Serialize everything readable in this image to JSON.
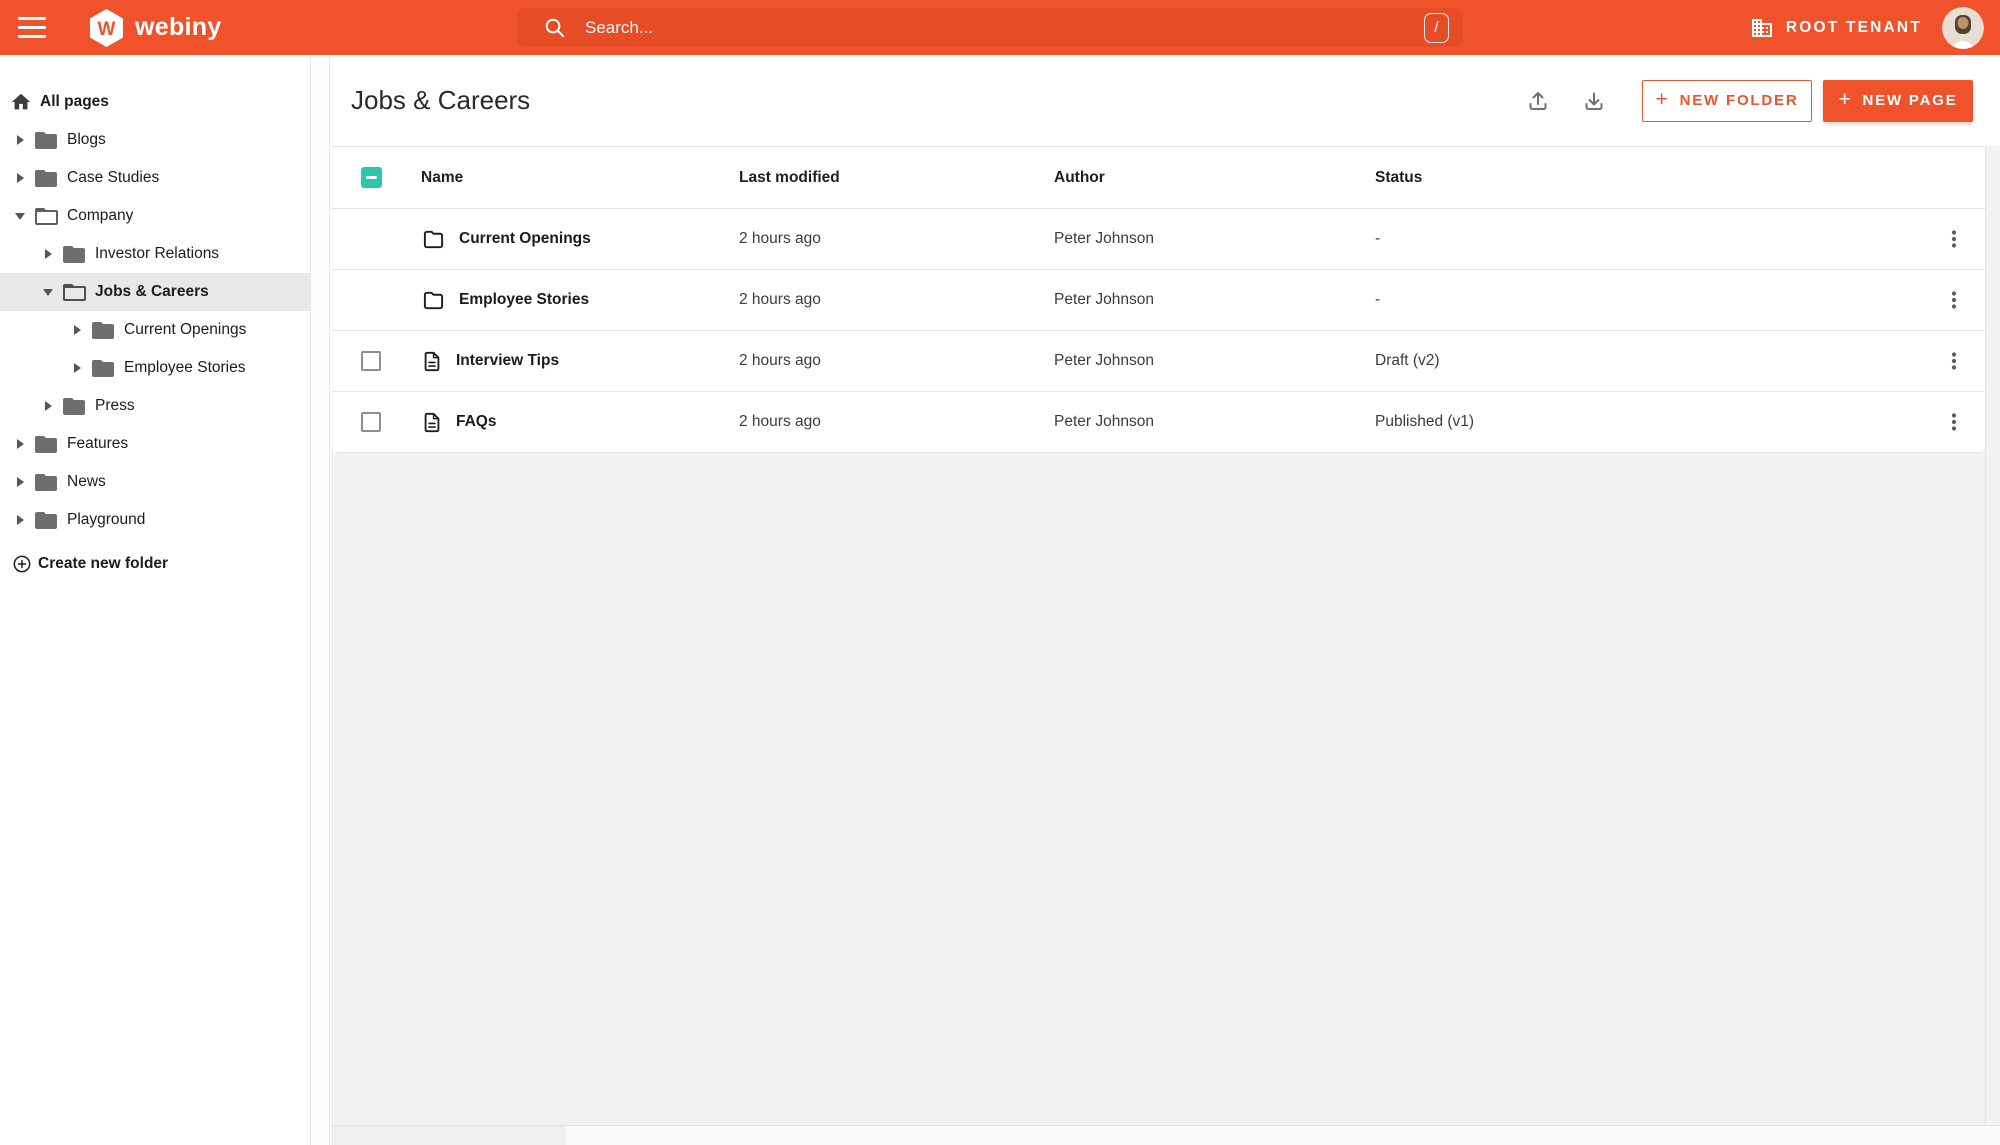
{
  "topbar": {
    "logo_text": "webiny",
    "search": {
      "placeholder": "Search...",
      "shortcut": "/"
    },
    "tenant": {
      "label": "ROOT TENANT"
    }
  },
  "sidebar": {
    "items": [
      {
        "label": "All pages",
        "type": "root",
        "depth": 0
      },
      {
        "label": "Blogs",
        "type": "folder",
        "depth": 1,
        "expanded": false
      },
      {
        "label": "Case Studies",
        "type": "folder",
        "depth": 1,
        "expanded": false
      },
      {
        "label": "Company",
        "type": "folder",
        "depth": 1,
        "expanded": true
      },
      {
        "label": "Investor Relations",
        "type": "folder",
        "depth": 2,
        "expanded": false
      },
      {
        "label": "Jobs & Careers",
        "type": "folder",
        "depth": 2,
        "expanded": true,
        "selected": true
      },
      {
        "label": "Current Openings",
        "type": "folder",
        "depth": 3,
        "expanded": false
      },
      {
        "label": "Employee Stories",
        "type": "folder",
        "depth": 3,
        "expanded": false
      },
      {
        "label": "Press",
        "type": "folder",
        "depth": 2,
        "expanded": false
      },
      {
        "label": "Features",
        "type": "folder",
        "depth": 1,
        "expanded": false
      },
      {
        "label": "News",
        "type": "folder",
        "depth": 1,
        "expanded": false
      },
      {
        "label": "Playground",
        "type": "folder",
        "depth": 1,
        "expanded": false
      }
    ],
    "create_folder_label": "Create new folder"
  },
  "main": {
    "title": "Jobs & Careers",
    "buttons": {
      "new_folder": "NEW FOLDER",
      "new_page": "NEW PAGE",
      "plus": "+"
    },
    "table": {
      "headers": {
        "name": "Name",
        "modified": "Last modified",
        "author": "Author",
        "status": "Status"
      },
      "rows": [
        {
          "name": "Current Openings",
          "type": "folder",
          "modified": "2 hours ago",
          "author": "Peter Johnson",
          "status": "-"
        },
        {
          "name": "Employee Stories",
          "type": "folder",
          "modified": "2 hours ago",
          "author": "Peter Johnson",
          "status": "-"
        },
        {
          "name": "Interview Tips",
          "type": "page",
          "modified": "2 hours ago",
          "author": "Peter Johnson",
          "status": "Draft (v2)"
        },
        {
          "name": "FAQs",
          "type": "page",
          "modified": "2 hours ago",
          "author": "Peter Johnson",
          "status": "Published (v1)"
        }
      ]
    }
  },
  "colors": {
    "accent": "#f0522b",
    "checkbox_teal": "#2ec6ab",
    "topbar": "#f0522b"
  }
}
